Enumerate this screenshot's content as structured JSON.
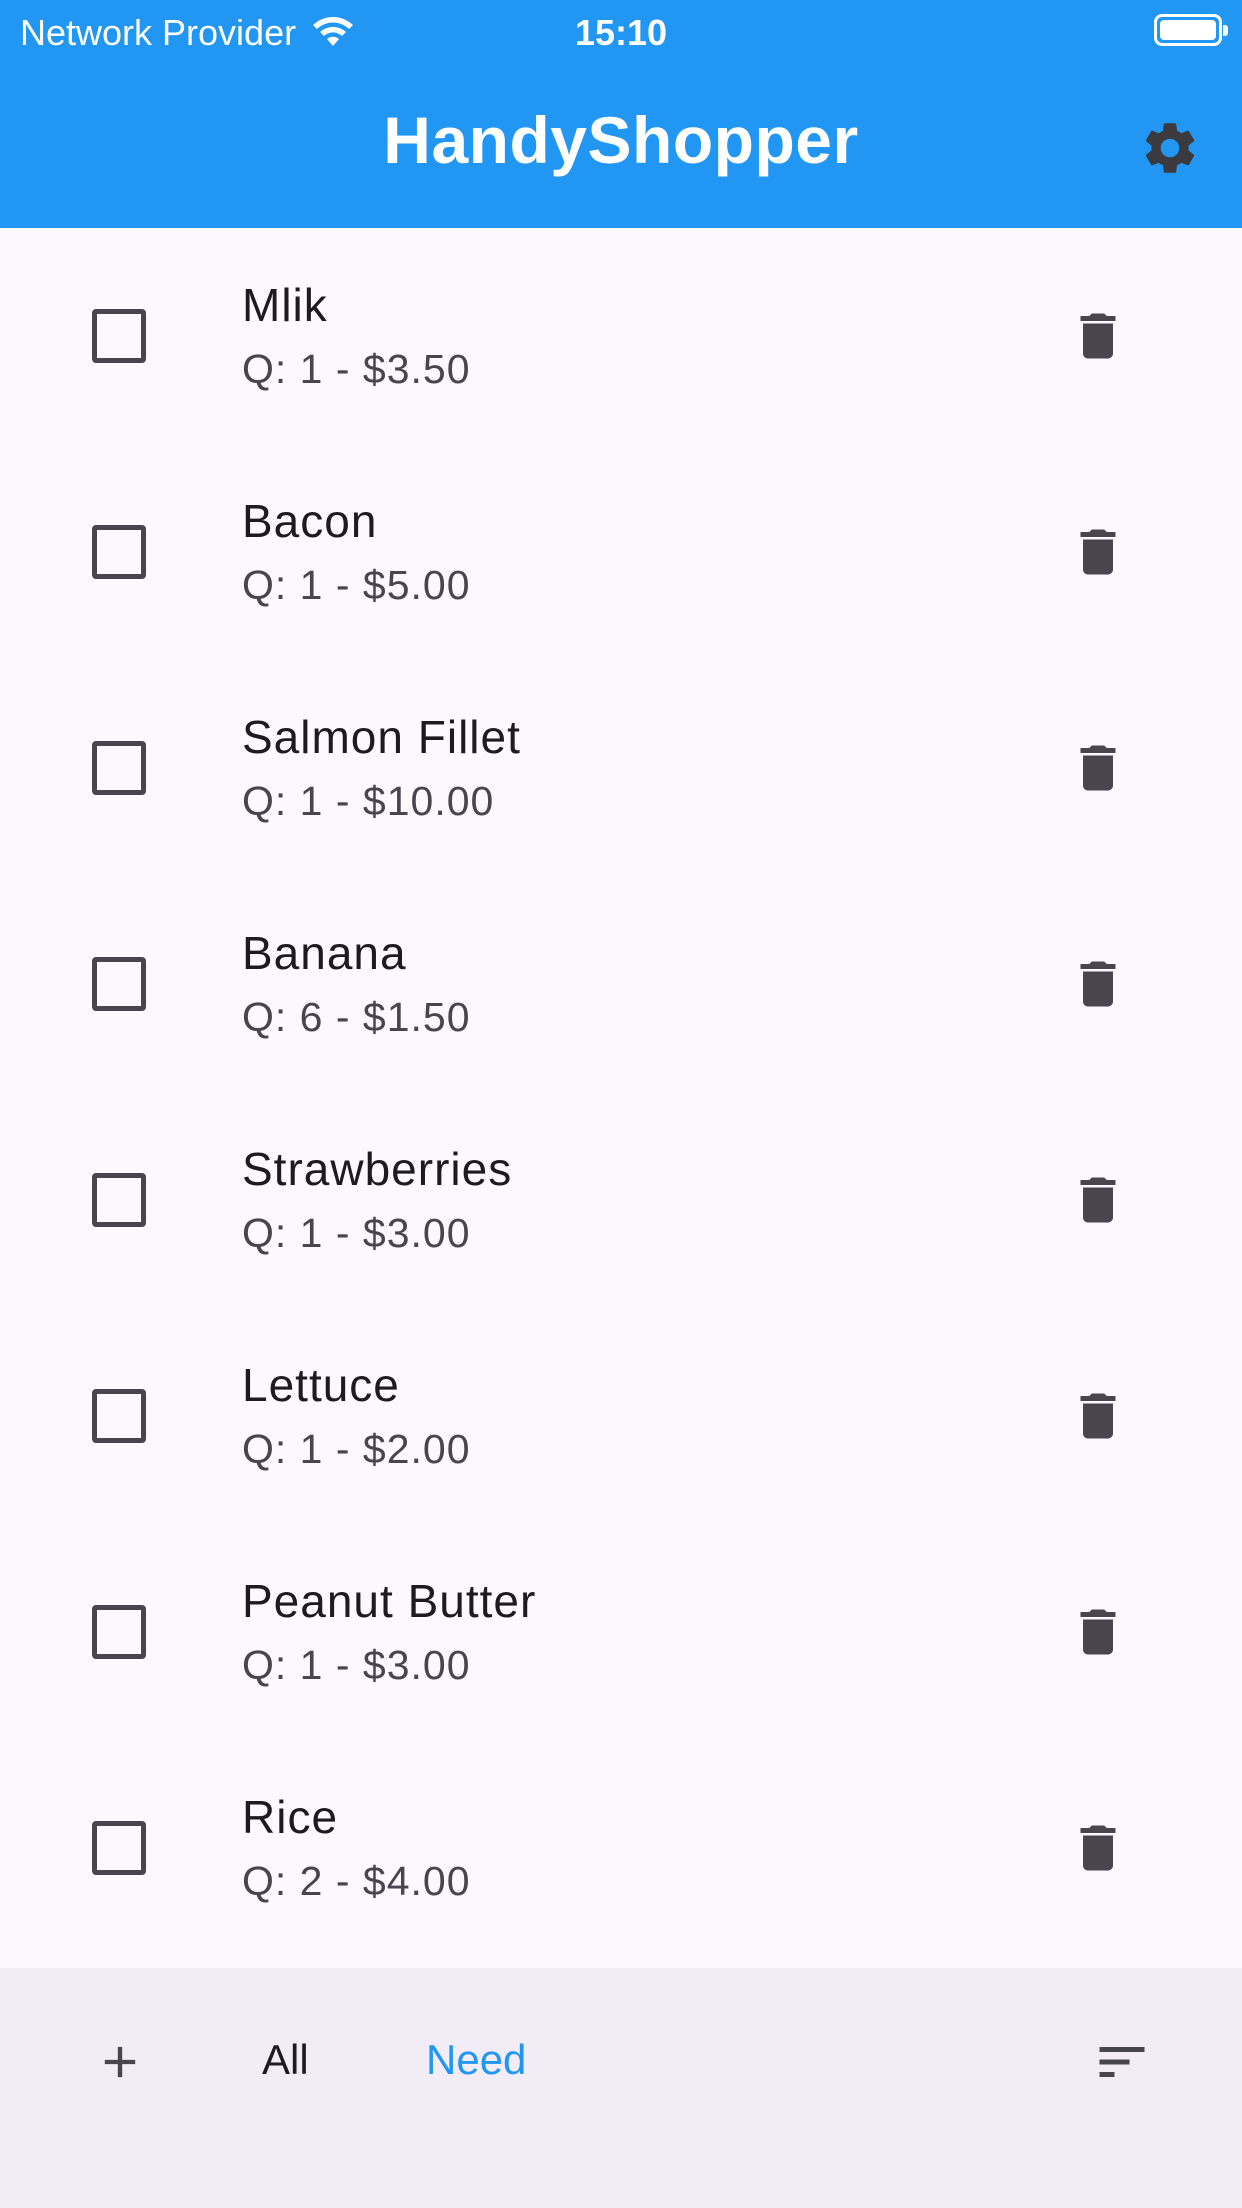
{
  "status_bar": {
    "carrier": "Network Provider",
    "time": "15:10"
  },
  "app_bar": {
    "title": "HandyShopper",
    "settings_icon": "gear-icon"
  },
  "items": [
    {
      "name": "Mlik",
      "detail": "Q: 1 - $3.50",
      "checked": false
    },
    {
      "name": "Bacon",
      "detail": "Q: 1 - $5.00",
      "checked": false
    },
    {
      "name": "Salmon Fillet",
      "detail": "Q: 1 - $10.00",
      "checked": false
    },
    {
      "name": "Banana",
      "detail": "Q: 6 - $1.50",
      "checked": false
    },
    {
      "name": "Strawberries",
      "detail": "Q: 1 - $3.00",
      "checked": false
    },
    {
      "name": "Lettuce",
      "detail": "Q: 1 - $2.00",
      "checked": false
    },
    {
      "name": "Peanut Butter",
      "detail": "Q: 1 - $3.00",
      "checked": false
    },
    {
      "name": "Rice",
      "detail": "Q: 2 - $4.00",
      "checked": false
    }
  ],
  "bottom_bar": {
    "add_icon": "plus-icon",
    "tab_all": "All",
    "tab_need": "Need",
    "sort_icon": "sort-icon"
  },
  "colors": {
    "primary": "#2196f3",
    "background": "#fdf8fd",
    "bottom_bar": "#f1ecf5",
    "icon": "#49454f"
  }
}
